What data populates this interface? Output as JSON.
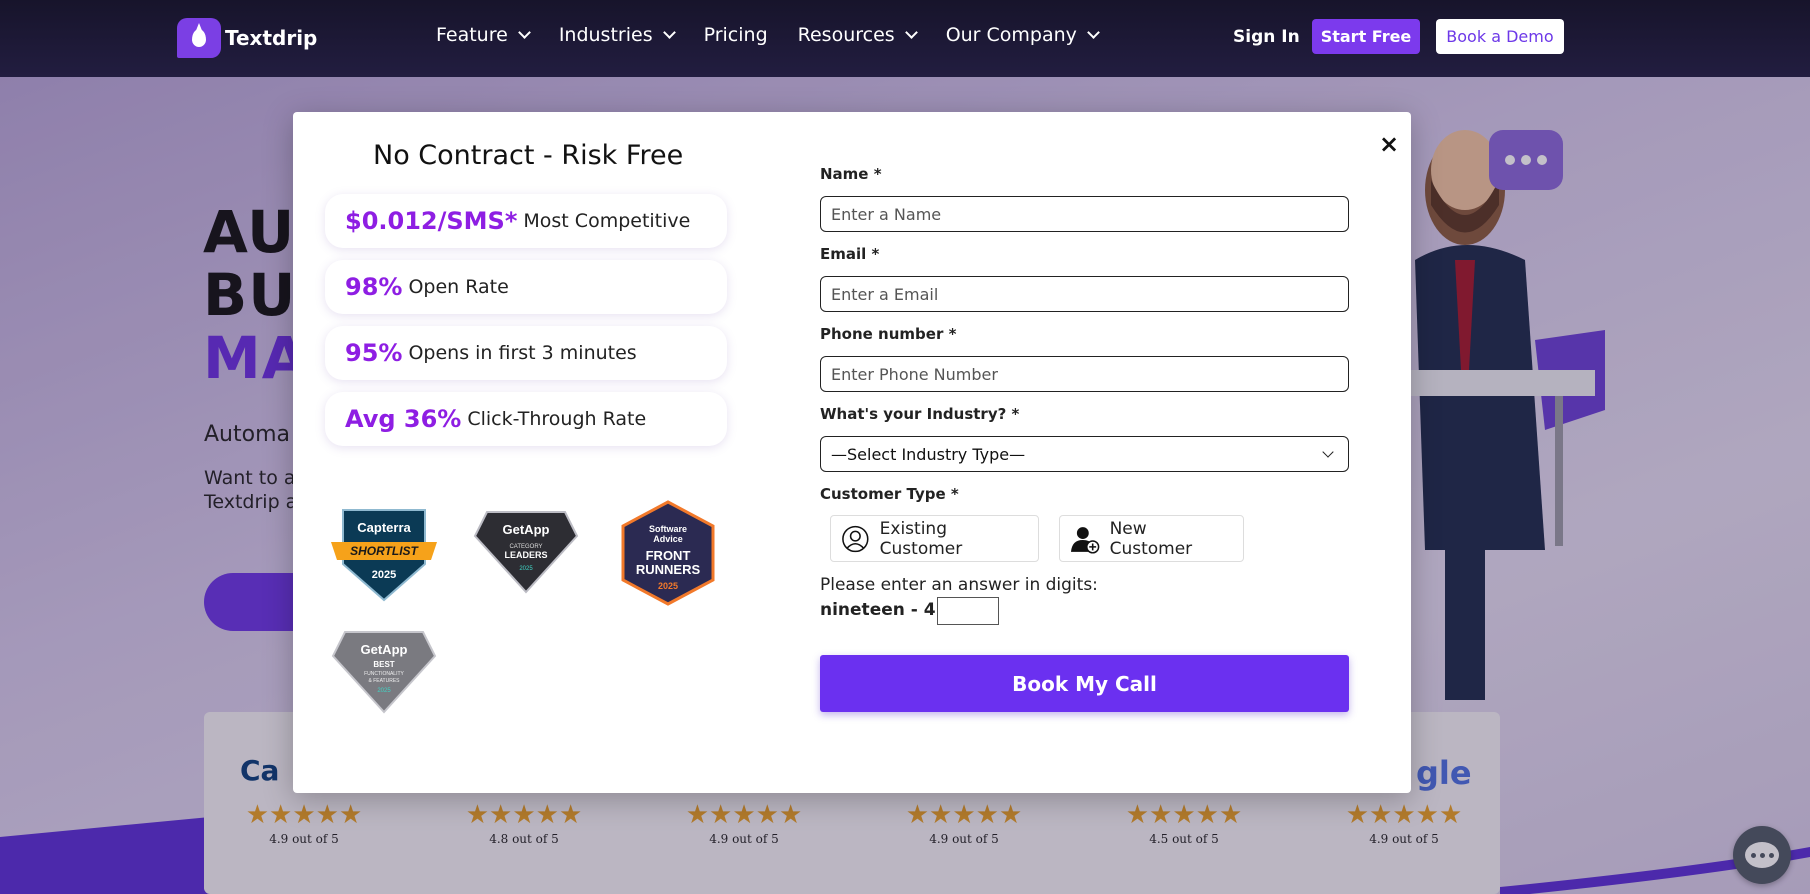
{
  "nav": {
    "logo_text": "Textdrip",
    "links": [
      {
        "label": "Feature",
        "dropdown": true
      },
      {
        "label": "Industries",
        "dropdown": true
      },
      {
        "label": "Pricing",
        "dropdown": false
      },
      {
        "label": "Resources",
        "dropdown": true
      },
      {
        "label": "Our Company",
        "dropdown": true
      }
    ],
    "sign_in": "Sign In",
    "start_free": "Start Free",
    "book_demo": "Book a Demo"
  },
  "hero": {
    "title_line1": "AU",
    "title_line2": "BUS",
    "title_line3": "MA",
    "subtitle": "Automa",
    "paragraph_line1": "Want to a",
    "paragraph_line2": "Textdrip a"
  },
  "reviews": [
    {
      "brand": "Ca",
      "stars": "★★★★★",
      "rating": "4.9 out of 5"
    },
    {
      "brand": "",
      "stars": "★★★★★",
      "rating": "4.8 out of 5"
    },
    {
      "brand": "",
      "stars": "★★★★★",
      "rating": "4.9 out of 5"
    },
    {
      "brand": "",
      "stars": "★★★★★",
      "rating": "4.9 out of 5"
    },
    {
      "brand": "",
      "stars": "★★★★★",
      "rating": "4.5 out of 5"
    },
    {
      "brand": "gle",
      "stars": "★★★★★",
      "rating": "4.9 out of 5"
    }
  ],
  "modal": {
    "close_icon": "×",
    "title": "No Contract - Risk Free",
    "stats": [
      {
        "value": "$0.012/SMS*",
        "label": "Most Competitive"
      },
      {
        "value": "98%",
        "label": "Open Rate"
      },
      {
        "value": "95%",
        "label": "Opens in first 3 minutes"
      },
      {
        "value": "Avg 36%",
        "label": "Click-Through Rate"
      }
    ],
    "badges": {
      "capterra": {
        "name": "Capterra",
        "ribbon": "SHORTLIST",
        "year": "2025"
      },
      "getapp_leaders": {
        "name": "GetApp",
        "line1": "CATEGORY",
        "line2": "LEADERS",
        "year": "2025"
      },
      "software_advice": {
        "line1": "Software",
        "line2": "Advice",
        "line3": "FRONT",
        "line4": "RUNNERS",
        "year": "2025"
      },
      "getapp_best": {
        "name": "GetApp",
        "line1": "BEST",
        "line2": "FUNCTIONALITY",
        "line3": "& FEATURES",
        "year": "2025"
      }
    },
    "form": {
      "name_label": "Name *",
      "name_placeholder": "Enter a Name",
      "email_label": "Email *",
      "email_placeholder": "Enter a Email",
      "phone_label": "Phone number *",
      "phone_placeholder": "Enter Phone Number",
      "industry_label": "What's your Industry? *",
      "industry_selected": "—Select Industry Type—",
      "customer_type_label": "Customer Type *",
      "existing_customer": "Existing Customer",
      "new_customer": "New Customer",
      "captcha_prompt": "Please enter an answer in digits:",
      "captcha_expression": "nineteen - 4 =",
      "submit": "Book My Call"
    }
  },
  "colors": {
    "brand_purple": "#6b30f0",
    "stat_purple": "#8e1ee3",
    "nav_bg": "#17142b"
  }
}
